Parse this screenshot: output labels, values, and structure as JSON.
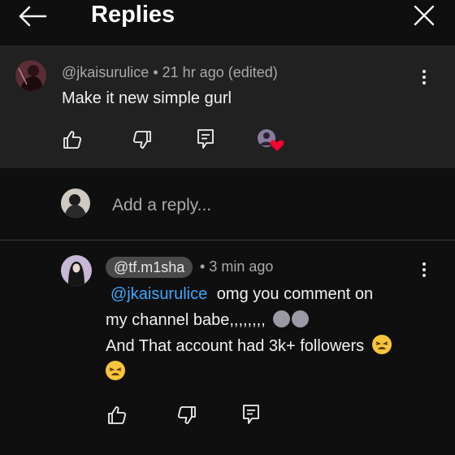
{
  "header": {
    "title": "Replies"
  },
  "parent": {
    "author": "@jkaisurulice",
    "time": "21 hr ago (edited)",
    "separator": "•",
    "text": "Make it new simple gurl"
  },
  "reply_bar": {
    "placeholder": "Add a reply..."
  },
  "reply": {
    "author": "@tf.m1sha",
    "separator": "•",
    "time": "3 min ago",
    "mention": "@jkaisurulice",
    "text_1": "omg you comment on",
    "text_2": "my channel babe,,,,,,,,",
    "text_3": "And That account had 3k+ followers"
  },
  "colors": {
    "background": "#0f0f0f",
    "parent_bg": "#212121",
    "mention_blue": "#3ea6ff",
    "heart_red": "#ff0033"
  },
  "icons": [
    "back-arrow-icon",
    "close-icon",
    "more-vert-icon",
    "like-icon",
    "dislike-icon",
    "reply-icon",
    "creator-heart-icon",
    "moon-emoji-icon",
    "tired-face-emoji-icon"
  ]
}
